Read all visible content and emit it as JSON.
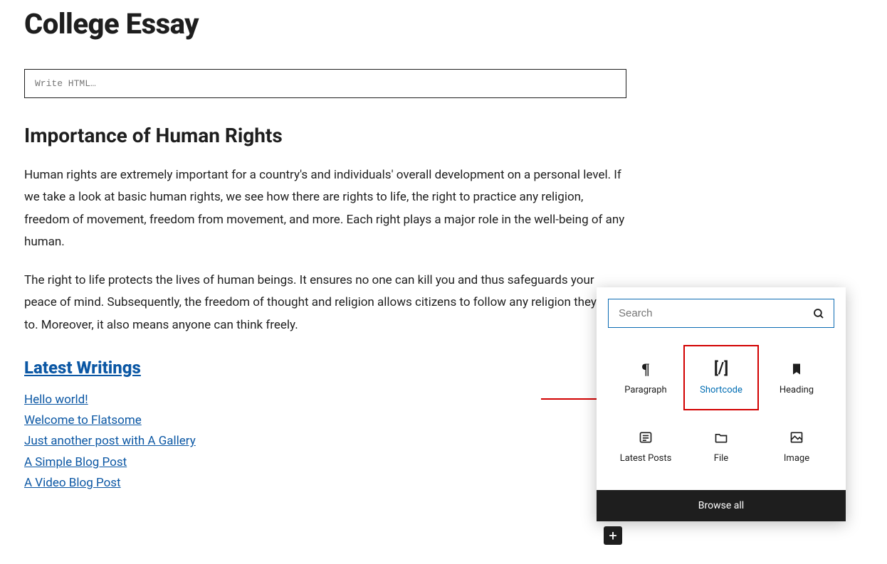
{
  "post": {
    "title": "College Essay",
    "html_block_placeholder": "Write HTML…",
    "subheading": "Importance of Human Rights",
    "para1": "Human rights are extremely important for a country's and individuals' overall development on a personal level. If we take a look at basic human rights, we see how there are rights to life, the right to practice any religion, freedom of movement, freedom from movement, and more. Each right plays a major role in the well-being of any human.",
    "para2": "The right to life protects the lives of human beings. It ensures no one can kill you and thus safeguards your peace of mind. Subsequently, the freedom of thought and religion allows citizens to follow any religion they wish to. Moreover, it also means anyone can think freely.",
    "latest_heading": "Latest Writings",
    "posts": [
      "Hello world!",
      "Welcome to Flatsome",
      "Just another post with A Gallery",
      "A Simple Blog Post",
      "A Video Blog Post"
    ]
  },
  "inserter": {
    "search_placeholder": "Search",
    "blocks": {
      "paragraph": "Paragraph",
      "shortcode": "Shortcode",
      "heading": "Heading",
      "latest_posts": "Latest Posts",
      "file": "File",
      "image": "Image"
    },
    "browse_all": "Browse all"
  }
}
